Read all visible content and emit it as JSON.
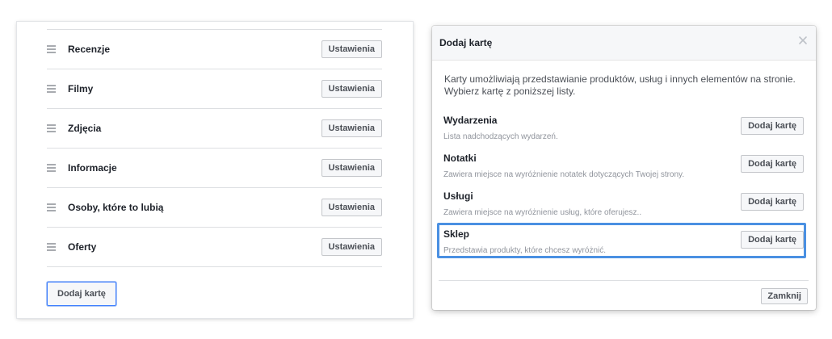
{
  "tabs_panel": {
    "rows": [
      {
        "label": "Recenzje",
        "button": "Ustawienia"
      },
      {
        "label": "Filmy",
        "button": "Ustawienia"
      },
      {
        "label": "Zdjęcia",
        "button": "Ustawienia"
      },
      {
        "label": "Informacje",
        "button": "Ustawienia"
      },
      {
        "label": "Osoby, które to lubią",
        "button": "Ustawienia"
      },
      {
        "label": "Oferty",
        "button": "Ustawienia"
      }
    ],
    "add_tab_label": "Dodaj kartę"
  },
  "dialog": {
    "title": "Dodaj kartę",
    "close_icon": "close-icon",
    "intro": "Karty umożliwiają przedstawianie produktów, usług i innych elementów na stronie. Wybierz kartę z poniższej listy.",
    "options": [
      {
        "title": "Wydarzenia",
        "description": "Lista nadchodzących wydarzeń.",
        "button": "Dodaj kartę"
      },
      {
        "title": "Notatki",
        "description": "Zawiera miejsce na wyróżnienie notatek dotyczących Twojej strony.",
        "button": "Dodaj kartę"
      },
      {
        "title": "Usługi",
        "description": "Zawiera miejsce na wyróżnienie usług, które oferujesz..",
        "button": "Dodaj kartę"
      },
      {
        "title": "Sklep",
        "description": "Przedstawia produkty, które chcesz wyróżnić.",
        "button": "Dodaj kartę",
        "highlighted": true
      }
    ],
    "close_button": "Zamknij"
  },
  "colors": {
    "highlight": "#4a90e2",
    "button_bg": "#f6f7f9",
    "header_bg": "#f6f7f9",
    "muted_text": "#90949c"
  }
}
